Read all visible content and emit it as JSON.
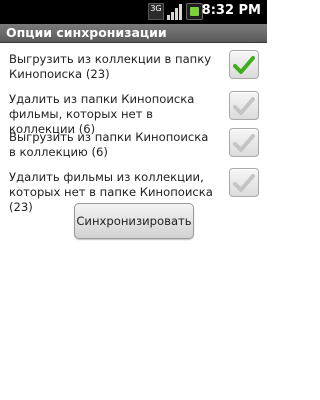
{
  "status_bar": {
    "network_label": "3G",
    "time": "8:32 PM",
    "icons": [
      "network-3g-icon",
      "signal-strength-icon",
      "battery-icon"
    ]
  },
  "title_bar": {
    "title": "Опции синхронизации"
  },
  "options": [
    {
      "label": "Выгрузить из коллекции в папку Кинопоиска (23)",
      "checked": true
    },
    {
      "label": "Удалить из папки Кинопоиска фильмы, которых нет в коллекции (6)",
      "checked": false
    },
    {
      "label": "Выгрузить из папки Кинопоиска в коллекцию (6)",
      "checked": false
    },
    {
      "label": "Удалить фильмы из коллекции, которых нет в папке Кинопоиска (23)",
      "checked": false
    }
  ],
  "sync_button": {
    "label": "Синхронизировать"
  },
  "colors": {
    "check_on": "#3fae1d",
    "check_off": "#c4c4c4",
    "title_bar": "#6a6a6a",
    "status_bar": "#000000"
  }
}
